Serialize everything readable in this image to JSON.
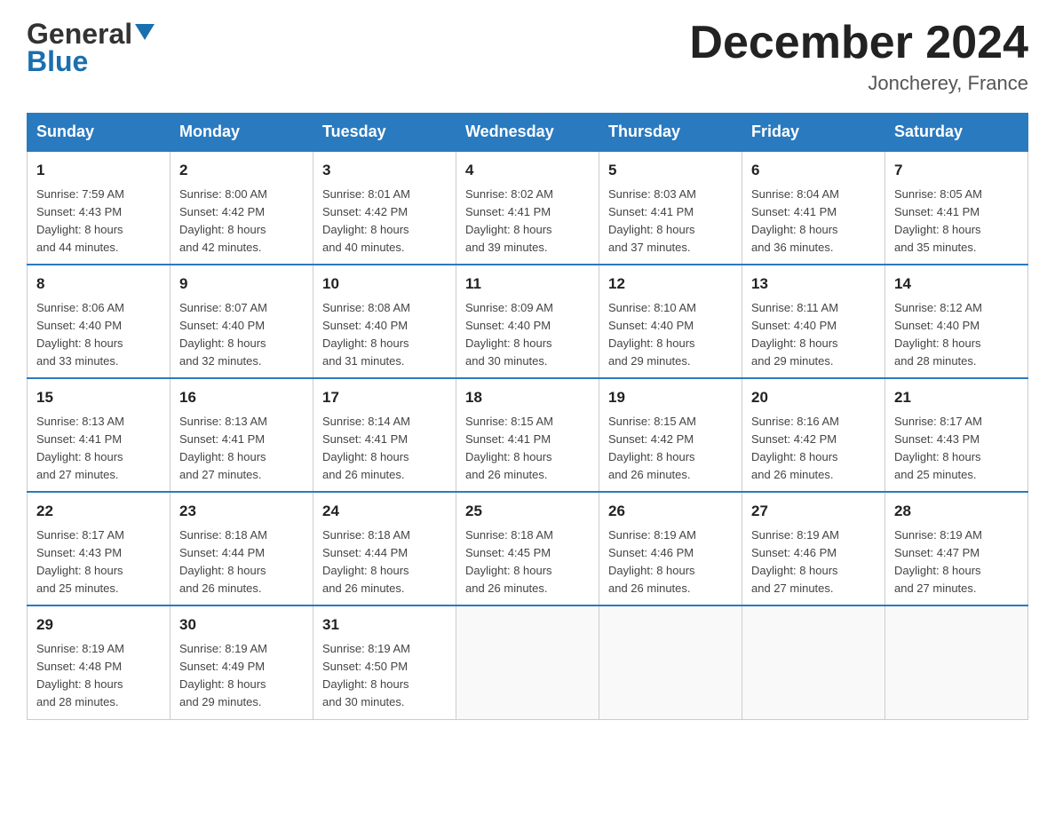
{
  "header": {
    "logo_general": "General",
    "logo_blue": "Blue",
    "month_title": "December 2024",
    "location": "Joncherey, France"
  },
  "weekdays": [
    "Sunday",
    "Monday",
    "Tuesday",
    "Wednesday",
    "Thursday",
    "Friday",
    "Saturday"
  ],
  "weeks": [
    [
      {
        "day": "1",
        "sunrise": "7:59 AM",
        "sunset": "4:43 PM",
        "daylight": "8 hours and 44 minutes."
      },
      {
        "day": "2",
        "sunrise": "8:00 AM",
        "sunset": "4:42 PM",
        "daylight": "8 hours and 42 minutes."
      },
      {
        "day": "3",
        "sunrise": "8:01 AM",
        "sunset": "4:42 PM",
        "daylight": "8 hours and 40 minutes."
      },
      {
        "day": "4",
        "sunrise": "8:02 AM",
        "sunset": "4:41 PM",
        "daylight": "8 hours and 39 minutes."
      },
      {
        "day": "5",
        "sunrise": "8:03 AM",
        "sunset": "4:41 PM",
        "daylight": "8 hours and 37 minutes."
      },
      {
        "day": "6",
        "sunrise": "8:04 AM",
        "sunset": "4:41 PM",
        "daylight": "8 hours and 36 minutes."
      },
      {
        "day": "7",
        "sunrise": "8:05 AM",
        "sunset": "4:41 PM",
        "daylight": "8 hours and 35 minutes."
      }
    ],
    [
      {
        "day": "8",
        "sunrise": "8:06 AM",
        "sunset": "4:40 PM",
        "daylight": "8 hours and 33 minutes."
      },
      {
        "day": "9",
        "sunrise": "8:07 AM",
        "sunset": "4:40 PM",
        "daylight": "8 hours and 32 minutes."
      },
      {
        "day": "10",
        "sunrise": "8:08 AM",
        "sunset": "4:40 PM",
        "daylight": "8 hours and 31 minutes."
      },
      {
        "day": "11",
        "sunrise": "8:09 AM",
        "sunset": "4:40 PM",
        "daylight": "8 hours and 30 minutes."
      },
      {
        "day": "12",
        "sunrise": "8:10 AM",
        "sunset": "4:40 PM",
        "daylight": "8 hours and 29 minutes."
      },
      {
        "day": "13",
        "sunrise": "8:11 AM",
        "sunset": "4:40 PM",
        "daylight": "8 hours and 29 minutes."
      },
      {
        "day": "14",
        "sunrise": "8:12 AM",
        "sunset": "4:40 PM",
        "daylight": "8 hours and 28 minutes."
      }
    ],
    [
      {
        "day": "15",
        "sunrise": "8:13 AM",
        "sunset": "4:41 PM",
        "daylight": "8 hours and 27 minutes."
      },
      {
        "day": "16",
        "sunrise": "8:13 AM",
        "sunset": "4:41 PM",
        "daylight": "8 hours and 27 minutes."
      },
      {
        "day": "17",
        "sunrise": "8:14 AM",
        "sunset": "4:41 PM",
        "daylight": "8 hours and 26 minutes."
      },
      {
        "day": "18",
        "sunrise": "8:15 AM",
        "sunset": "4:41 PM",
        "daylight": "8 hours and 26 minutes."
      },
      {
        "day": "19",
        "sunrise": "8:15 AM",
        "sunset": "4:42 PM",
        "daylight": "8 hours and 26 minutes."
      },
      {
        "day": "20",
        "sunrise": "8:16 AM",
        "sunset": "4:42 PM",
        "daylight": "8 hours and 26 minutes."
      },
      {
        "day": "21",
        "sunrise": "8:17 AM",
        "sunset": "4:43 PM",
        "daylight": "8 hours and 25 minutes."
      }
    ],
    [
      {
        "day": "22",
        "sunrise": "8:17 AM",
        "sunset": "4:43 PM",
        "daylight": "8 hours and 25 minutes."
      },
      {
        "day": "23",
        "sunrise": "8:18 AM",
        "sunset": "4:44 PM",
        "daylight": "8 hours and 26 minutes."
      },
      {
        "day": "24",
        "sunrise": "8:18 AM",
        "sunset": "4:44 PM",
        "daylight": "8 hours and 26 minutes."
      },
      {
        "day": "25",
        "sunrise": "8:18 AM",
        "sunset": "4:45 PM",
        "daylight": "8 hours and 26 minutes."
      },
      {
        "day": "26",
        "sunrise": "8:19 AM",
        "sunset": "4:46 PM",
        "daylight": "8 hours and 26 minutes."
      },
      {
        "day": "27",
        "sunrise": "8:19 AM",
        "sunset": "4:46 PM",
        "daylight": "8 hours and 27 minutes."
      },
      {
        "day": "28",
        "sunrise": "8:19 AM",
        "sunset": "4:47 PM",
        "daylight": "8 hours and 27 minutes."
      }
    ],
    [
      {
        "day": "29",
        "sunrise": "8:19 AM",
        "sunset": "4:48 PM",
        "daylight": "8 hours and 28 minutes."
      },
      {
        "day": "30",
        "sunrise": "8:19 AM",
        "sunset": "4:49 PM",
        "daylight": "8 hours and 29 minutes."
      },
      {
        "day": "31",
        "sunrise": "8:19 AM",
        "sunset": "4:50 PM",
        "daylight": "8 hours and 30 minutes."
      },
      null,
      null,
      null,
      null
    ]
  ],
  "labels": {
    "sunrise": "Sunrise:",
    "sunset": "Sunset:",
    "daylight": "Daylight:"
  }
}
